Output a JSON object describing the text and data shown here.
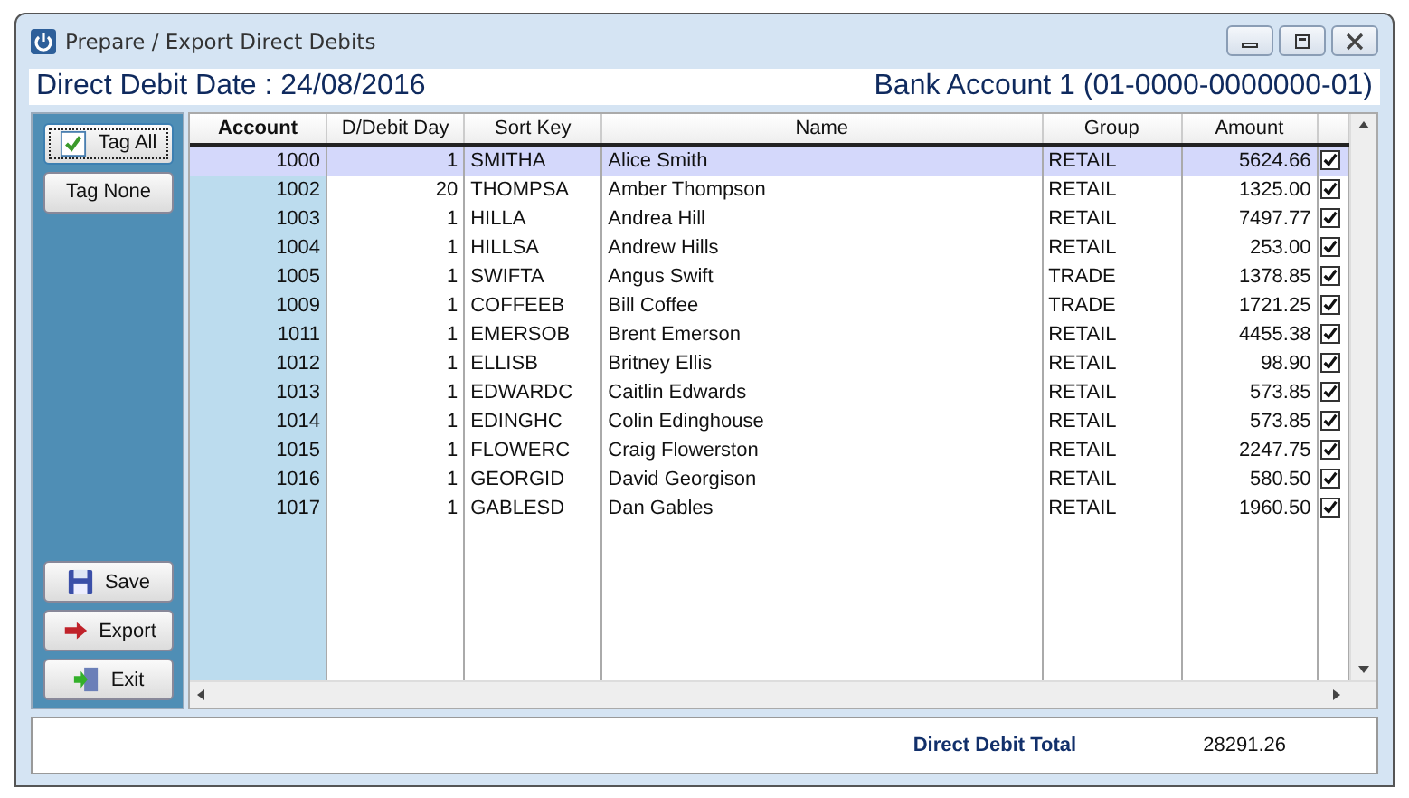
{
  "window": {
    "title": "Prepare / Export Direct Debits"
  },
  "header": {
    "date": "Direct Debit Date : 24/08/2016",
    "bank_account": "Bank Account 1 (01-0000-0000000-01)"
  },
  "side_buttons": [
    {
      "label": "Tag All",
      "focused": true
    },
    {
      "label": "Tag None",
      "focused": false
    }
  ],
  "bottom_buttons": [
    {
      "label": "Save"
    },
    {
      "label": "Export"
    },
    {
      "label": "Exit"
    }
  ],
  "table": {
    "columns": [
      "Account",
      "D/Debit Day",
      "Sort Key",
      "Name",
      "Group",
      "Amount"
    ],
    "rows": [
      {
        "account": "1000",
        "day": "1",
        "sort_key": "SMITHA",
        "name": "Alice Smith",
        "group": "RETAIL",
        "amount": "5624.66",
        "checked": true,
        "selected": true
      },
      {
        "account": "1002",
        "day": "20",
        "sort_key": "THOMPSA",
        "name": "Amber Thompson",
        "group": "RETAIL",
        "amount": "1325.00",
        "checked": true,
        "selected": false
      },
      {
        "account": "1003",
        "day": "1",
        "sort_key": "HILLA",
        "name": "Andrea Hill",
        "group": "RETAIL",
        "amount": "7497.77",
        "checked": true,
        "selected": false
      },
      {
        "account": "1004",
        "day": "1",
        "sort_key": "HILLSA",
        "name": "Andrew Hills",
        "group": "RETAIL",
        "amount": "253.00",
        "checked": true,
        "selected": false
      },
      {
        "account": "1005",
        "day": "1",
        "sort_key": "SWIFTA",
        "name": "Angus Swift",
        "group": "TRADE",
        "amount": "1378.85",
        "checked": true,
        "selected": false
      },
      {
        "account": "1009",
        "day": "1",
        "sort_key": "COFFEEB",
        "name": "Bill Coffee",
        "group": "TRADE",
        "amount": "1721.25",
        "checked": true,
        "selected": false
      },
      {
        "account": "1011",
        "day": "1",
        "sort_key": "EMERSOB",
        "name": "Brent Emerson",
        "group": "RETAIL",
        "amount": "4455.38",
        "checked": true,
        "selected": false
      },
      {
        "account": "1012",
        "day": "1",
        "sort_key": "ELLISB",
        "name": "Britney Ellis",
        "group": "RETAIL",
        "amount": "98.90",
        "checked": true,
        "selected": false
      },
      {
        "account": "1013",
        "day": "1",
        "sort_key": "EDWARDC",
        "name": "Caitlin Edwards",
        "group": "RETAIL",
        "amount": "573.85",
        "checked": true,
        "selected": false
      },
      {
        "account": "1014",
        "day": "1",
        "sort_key": "EDINGHC",
        "name": "Colin Edinghouse",
        "group": "RETAIL",
        "amount": "573.85",
        "checked": true,
        "selected": false
      },
      {
        "account": "1015",
        "day": "1",
        "sort_key": "FLOWERC",
        "name": "Craig Flowerston",
        "group": "RETAIL",
        "amount": "2247.75",
        "checked": true,
        "selected": false
      },
      {
        "account": "1016",
        "day": "1",
        "sort_key": "GEORGID",
        "name": "David Georgison",
        "group": "RETAIL",
        "amount": "580.50",
        "checked": true,
        "selected": false
      },
      {
        "account": "1017",
        "day": "1",
        "sort_key": "GABLESD",
        "name": "Dan Gables",
        "group": "RETAIL",
        "amount": "1960.50",
        "checked": true,
        "selected": false
      }
    ]
  },
  "footer": {
    "label": "Direct Debit Total",
    "total": "28291.26"
  }
}
